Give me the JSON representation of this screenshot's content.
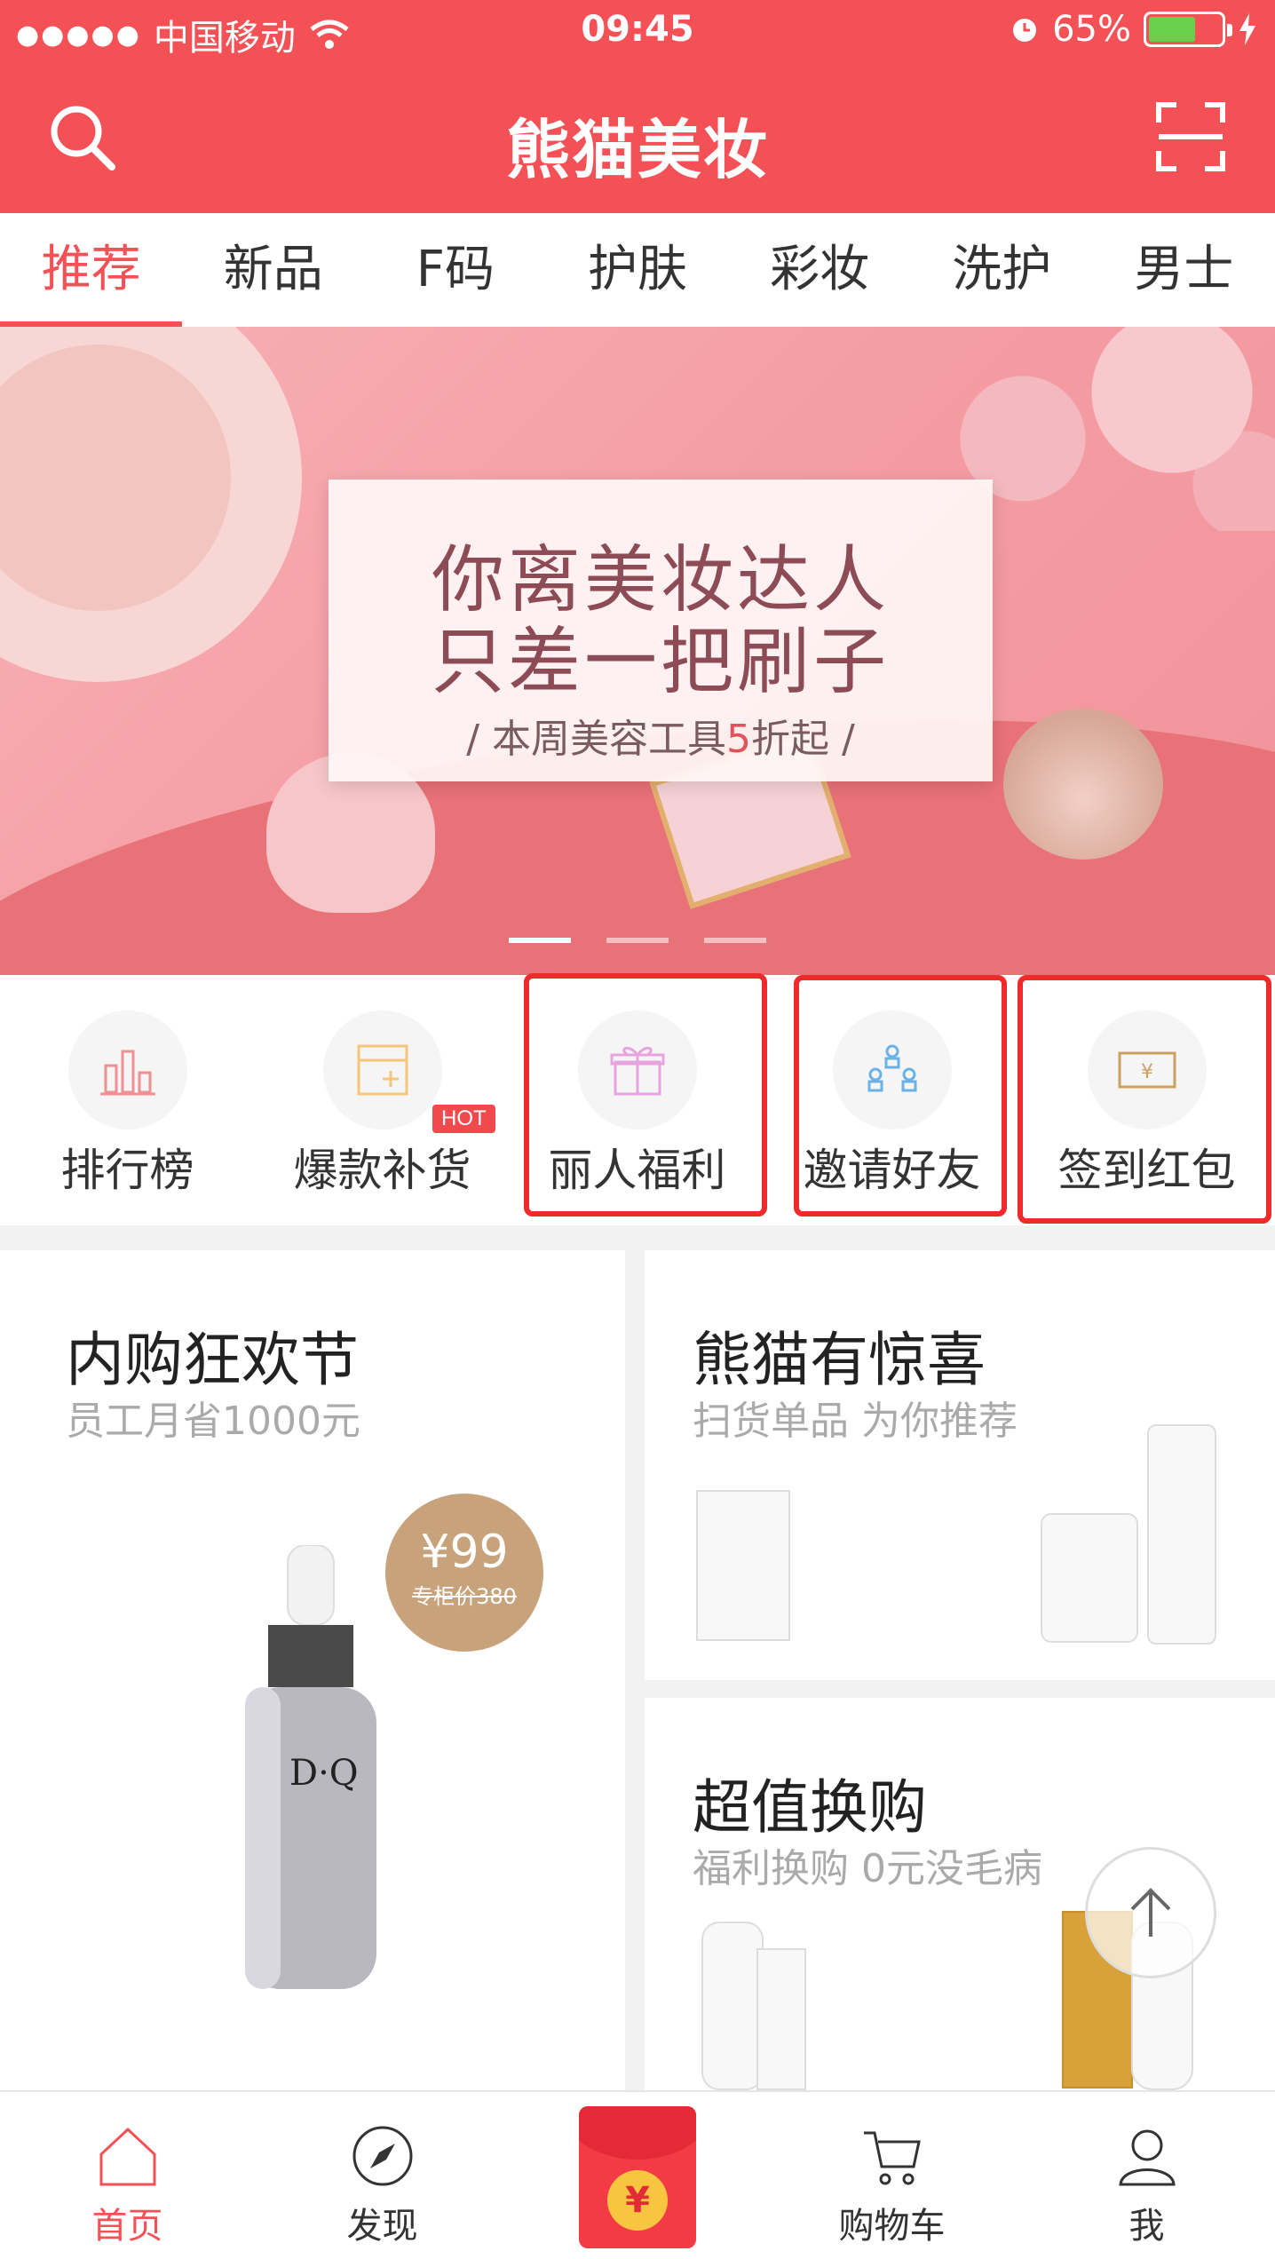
{
  "status_bar": {
    "carrier": "中国移动",
    "time": "09:45",
    "battery": "65%"
  },
  "header": {
    "title": "熊猫美妆",
    "search_icon": "search-icon",
    "scan_icon": "scan-icon"
  },
  "tabs": [
    {
      "label": "推荐",
      "active": true
    },
    {
      "label": "新品"
    },
    {
      "label": "F码"
    },
    {
      "label": "护肤"
    },
    {
      "label": "彩妆"
    },
    {
      "label": "洗护"
    },
    {
      "label": "男士"
    }
  ],
  "banner": {
    "line1": "你离美妆达人",
    "line2": "只差一把刷子",
    "line3_prefix": "/ 本周美容工具",
    "line3_highlight": "5",
    "line3_suffix": "折起 /",
    "page_count": 3,
    "active_page": 1
  },
  "quick_menu": [
    {
      "label": "排行榜",
      "icon": "chart-bars-icon",
      "color": "#f08f94"
    },
    {
      "label": "爆款补货",
      "icon": "box-plus-icon",
      "color": "#f5c57a",
      "badge": "HOT"
    },
    {
      "label": "丽人福利",
      "icon": "gift-icon",
      "color": "#e8a2e0"
    },
    {
      "label": "邀请好友",
      "icon": "people-icon",
      "color": "#6ab1e8"
    },
    {
      "label": "签到红包",
      "icon": "banknote-icon",
      "color": "#c9a160"
    }
  ],
  "features": {
    "left": {
      "title": "内购狂欢节",
      "subtitle": "员工月省1000元",
      "price": "¥99",
      "orig_price": "专柜价380",
      "product_brand": "D·Q"
    },
    "top_right": {
      "title": "熊猫有惊喜",
      "subtitle": "扫货单品 为你推荐"
    },
    "bottom_right": {
      "title": "超值换购",
      "subtitle": "福利换购 0元没毛病"
    }
  },
  "bottom_nav": [
    {
      "label": "首页",
      "icon": "home-icon",
      "active": true
    },
    {
      "label": "发现",
      "icon": "compass-icon"
    },
    {
      "label": "",
      "icon": "red-packet-icon"
    },
    {
      "label": "购物车",
      "icon": "cart-icon"
    },
    {
      "label": "我",
      "icon": "user-icon"
    }
  ],
  "colors": {
    "brand": "#f45156",
    "highlight_box": "#ee2a2a"
  }
}
